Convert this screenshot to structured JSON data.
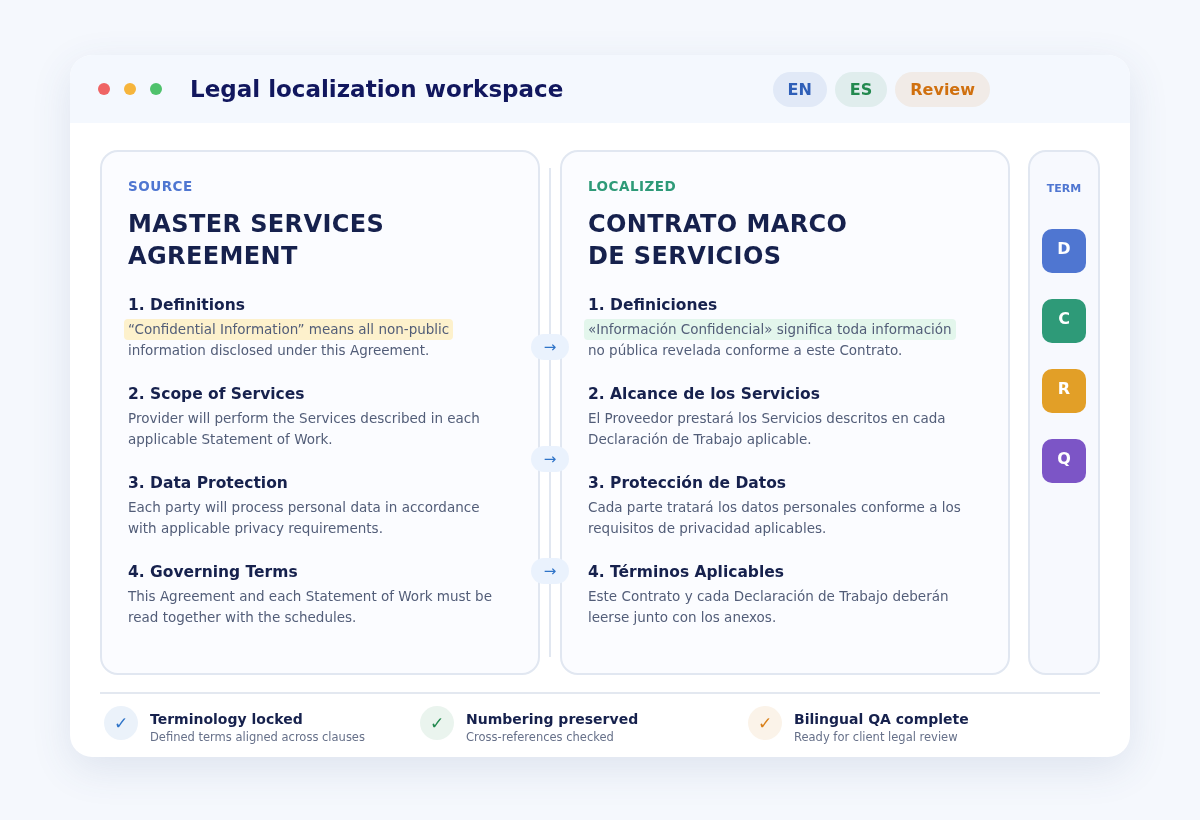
{
  "window": {
    "title": "Legal localization workspace",
    "badges": [
      {
        "label": "EN",
        "color": "#2f5fb8"
      },
      {
        "label": "ES",
        "color": "#23894f"
      },
      {
        "label": "Review",
        "color": "#d0700f"
      }
    ]
  },
  "source": {
    "label": "SOURCE",
    "title": "MASTER SERVICES AGREEMENT",
    "clauses": [
      {
        "heading": "1. Definitions",
        "lines": [
          "“Confidential Information” means all non-public",
          "information disclosed under this Agreement."
        ],
        "highlight": true
      },
      {
        "heading": "2. Scope of Services",
        "lines": [
          "Provider will perform the Services described in each",
          "applicable Statement of Work."
        ],
        "highlight": false
      },
      {
        "heading": "3. Data Protection",
        "lines": [
          "Each party will process personal data in accordance",
          "with applicable privacy requirements."
        ],
        "highlight": false
      },
      {
        "heading": "4. Governing Terms",
        "lines": [
          "This Agreement and each Statement of Work must be",
          "read together with the schedules."
        ],
        "highlight": false
      }
    ]
  },
  "arrows": [
    "→",
    "→",
    "→"
  ],
  "localized": {
    "label": "LOCALIZED",
    "title_lines": [
      "CONTRATO MARCO",
      "DE SERVICIOS"
    ],
    "clauses": [
      {
        "heading": "1. Definiciones",
        "lines": [
          "«Información Confidencial» significa toda información",
          "no pública revelada conforme a este Contrato."
        ],
        "highlight": true
      },
      {
        "heading": "2. Alcance de los Servicios",
        "lines": [
          "El Proveedor prestará los Servicios descritos en cada",
          "Declaración de Trabajo aplicable."
        ],
        "highlight": false
      },
      {
        "heading": "3. Protección de Datos",
        "lines": [
          "Cada parte tratará los datos personales conforme a los",
          "requisitos de privacidad aplicables."
        ],
        "highlight": false
      },
      {
        "heading": "4. Términos Aplicables",
        "lines": [
          "Este Contrato y cada Declaración de Trabajo deberán",
          "leerse junto con los anexos."
        ],
        "highlight": false
      }
    ]
  },
  "terms": {
    "label": "TERM",
    "items": [
      {
        "letter": "D",
        "color": "#4f76d1"
      },
      {
        "letter": "C",
        "color": "#2e9a78"
      },
      {
        "letter": "R",
        "color": "#e29f27"
      },
      {
        "letter": "Q",
        "color": "#7c55c6"
      }
    ]
  },
  "checks": [
    {
      "mark": "✓",
      "title": "Terminology locked",
      "subtitle": "Defined terms aligned across clauses",
      "color": "#2f74c8"
    },
    {
      "mark": "✓",
      "title": "Numbering preserved",
      "subtitle": "Cross-references checked",
      "color": "#23894f"
    },
    {
      "mark": "✓",
      "title": "Bilingual QA complete",
      "subtitle": "Ready for client legal review",
      "color": "#d9801a"
    }
  ]
}
